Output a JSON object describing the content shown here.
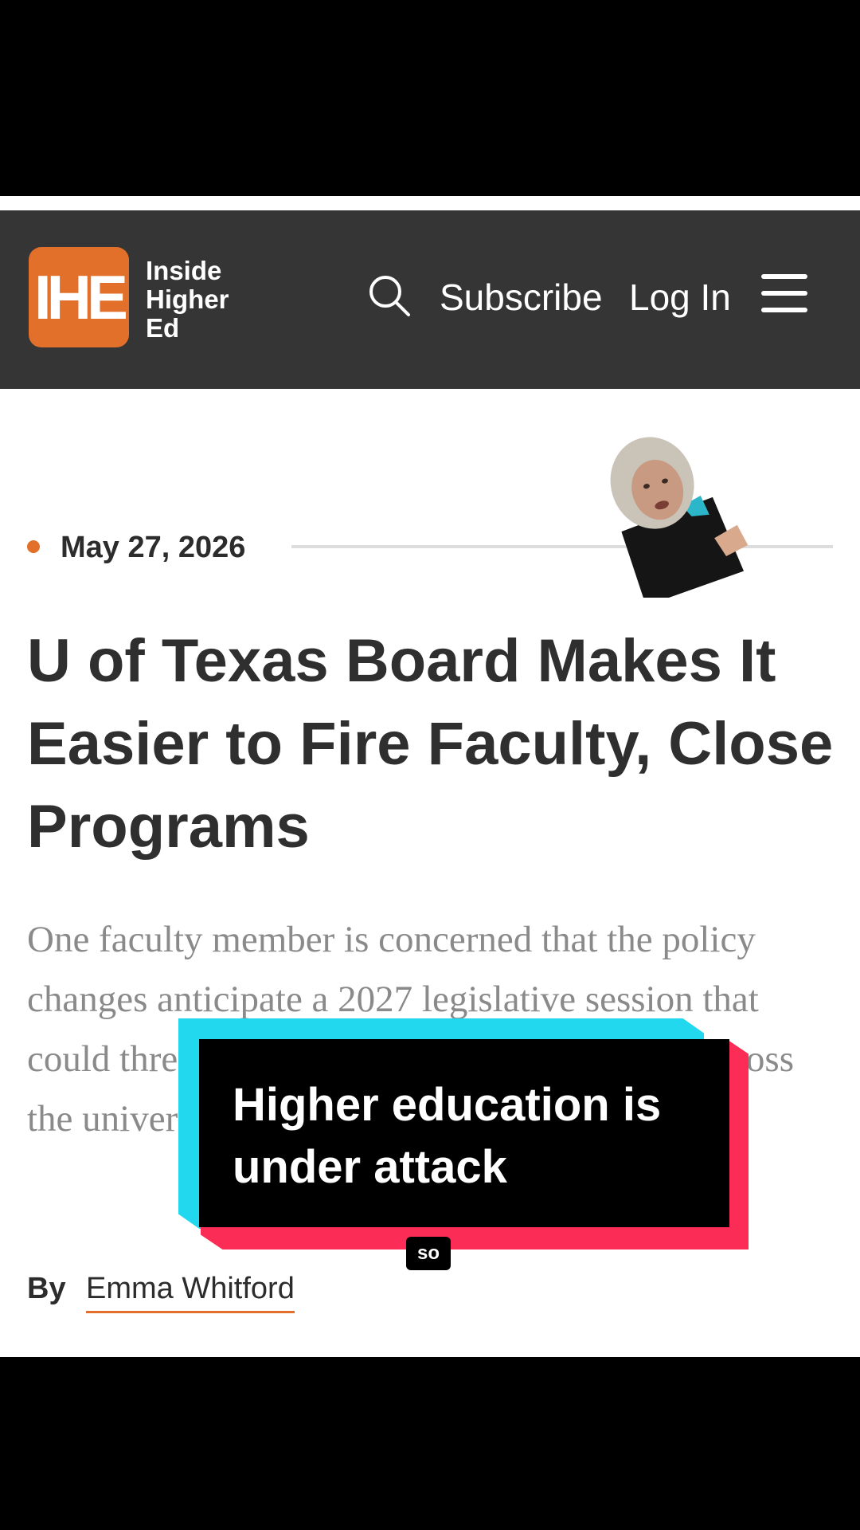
{
  "header": {
    "logo_mark": "IHE",
    "logo_lines": [
      "Inside",
      "Higher",
      "Ed"
    ],
    "subscribe_label": "Subscribe",
    "login_label": "Log In",
    "icons": [
      "search-icon",
      "menu-icon"
    ]
  },
  "article": {
    "date": "May 27, 2026",
    "headline": "U of Texas Board Makes It Easier to Fire Faculty, Close Programs",
    "dek": "One faculty member is concerned that the policy changes anticipate a 2027 legislative session that could threaten tenure and academic freedom across the university system.",
    "byline_prefix": "By",
    "author": "Emma Whitford"
  },
  "overlay": {
    "caption": "Higher education is under attack",
    "subtitle": "so"
  },
  "colors": {
    "brand_orange": "#e2702a",
    "header_bg": "#353535",
    "caption_cyan": "#21d8ee",
    "caption_red": "#fb2c56"
  }
}
